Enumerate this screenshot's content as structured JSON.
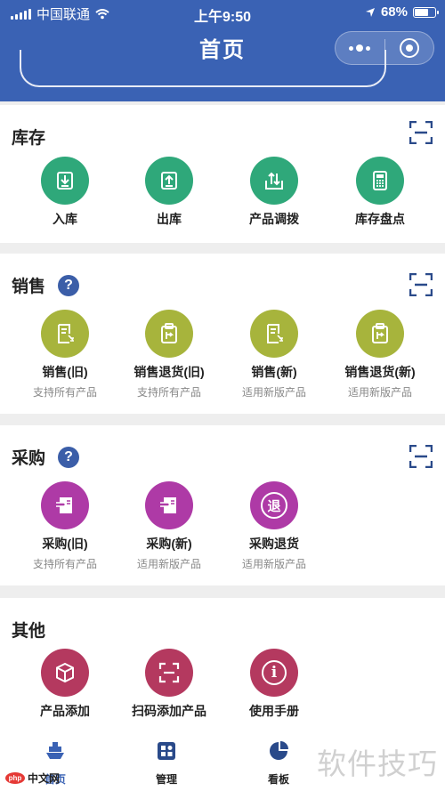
{
  "status_bar": {
    "carrier": "中国联通",
    "time": "上午9:50",
    "battery": "68%",
    "battery_level": 0.68
  },
  "header": {
    "title": "首页"
  },
  "sections": {
    "inventory": {
      "title": "库存",
      "items": [
        {
          "label": "入库",
          "icon": "inbound-icon"
        },
        {
          "label": "出库",
          "icon": "outbound-icon"
        },
        {
          "label": "产品调拨",
          "icon": "transfer-icon"
        },
        {
          "label": "库存盘点",
          "icon": "stocktake-icon"
        }
      ]
    },
    "sales": {
      "title": "销售",
      "help": "?",
      "items": [
        {
          "label": "销售(旧)",
          "sub": "支持所有产品",
          "icon": "sales-doc-icon"
        },
        {
          "label": "销售退货(旧)",
          "sub": "支持所有产品",
          "icon": "clipboard-return-icon"
        },
        {
          "label": "销售(新)",
          "sub": "适用新版产品",
          "icon": "sales-doc-icon"
        },
        {
          "label": "销售退货(新)",
          "sub": "适用新版产品",
          "icon": "clipboard-return-icon"
        }
      ]
    },
    "purchase": {
      "title": "采购",
      "help": "?",
      "items": [
        {
          "label": "采购(旧)",
          "sub": "支持所有产品",
          "icon": "purchase-icon"
        },
        {
          "label": "采购(新)",
          "sub": "适用新版产品",
          "icon": "purchase-icon"
        },
        {
          "label": "采购退货",
          "sub": "适用新版产品",
          "icon": "return-seal-icon",
          "glyph": "退"
        }
      ]
    },
    "other": {
      "title": "其他",
      "items": [
        {
          "label": "产品添加",
          "icon": "box-icon"
        },
        {
          "label": "扫码添加产品",
          "icon": "scan-icon"
        },
        {
          "label": "使用手册",
          "icon": "info-icon",
          "glyph": "i"
        }
      ]
    }
  },
  "tabbar": [
    {
      "label": "首页",
      "icon": "ship-home-icon",
      "active": true
    },
    {
      "label": "管理",
      "icon": "manage-icon",
      "active": false
    },
    {
      "label": "看板",
      "icon": "pie-dashboard-icon",
      "active": false
    }
  ],
  "watermark": {
    "text": "软件技巧",
    "logo": "php",
    "site": "中文网"
  },
  "colors": {
    "header": "#3a62b4",
    "inventory": "#2fa87a",
    "sales": "#a7b43c",
    "purchase": "#ae3aa6",
    "other": "#b4395f"
  }
}
